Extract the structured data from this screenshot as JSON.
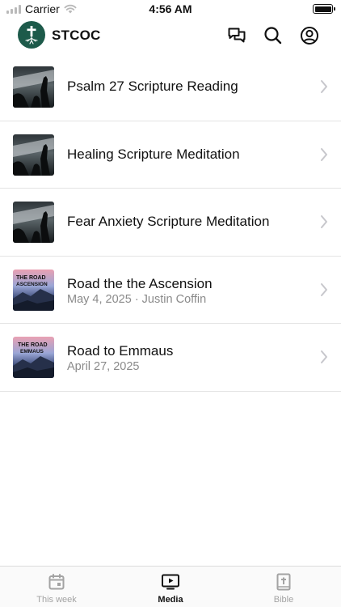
{
  "status_bar": {
    "carrier": "Carrier",
    "time": "4:56 AM"
  },
  "header": {
    "app_name": "STCOC",
    "icons": [
      "messages-icon",
      "search-icon",
      "profile-icon"
    ],
    "logo_color": "#1d5a4a"
  },
  "media_items": [
    {
      "title": "Psalm 27 Scripture Reading",
      "subtitle": "",
      "thumbnail": "hands-raised-worship"
    },
    {
      "title": "Healing Scripture Meditation",
      "subtitle": "",
      "thumbnail": "hands-raised-worship"
    },
    {
      "title": "Fear Anxiety Scripture Meditation",
      "subtitle": "",
      "thumbnail": "hands-raised-worship"
    },
    {
      "title": "Road the the Ascension",
      "subtitle": "May 4, 2025 · Justin Coffin",
      "thumbnail": "road-ascension-sunset",
      "thumb_text_1": "THE ROAD",
      "thumb_text_2": "ASCENSION"
    },
    {
      "title": "Road to Emmaus",
      "subtitle": "April 27, 2025",
      "thumbnail": "road-emmaus-sunset",
      "thumb_text_1": "THE ROAD",
      "thumb_text_2": "EMMAUS"
    }
  ],
  "tabs": [
    {
      "label": "This week",
      "icon": "calendar-icon",
      "active": false
    },
    {
      "label": "Media",
      "icon": "play-screen-icon",
      "active": true
    },
    {
      "label": "Bible",
      "icon": "bible-icon",
      "active": false
    }
  ],
  "colors": {
    "inactive_tab": "#a3a3a3",
    "active_tab": "#111111",
    "subtitle": "#8a8a8a",
    "chevron": "#c7c7cc"
  }
}
